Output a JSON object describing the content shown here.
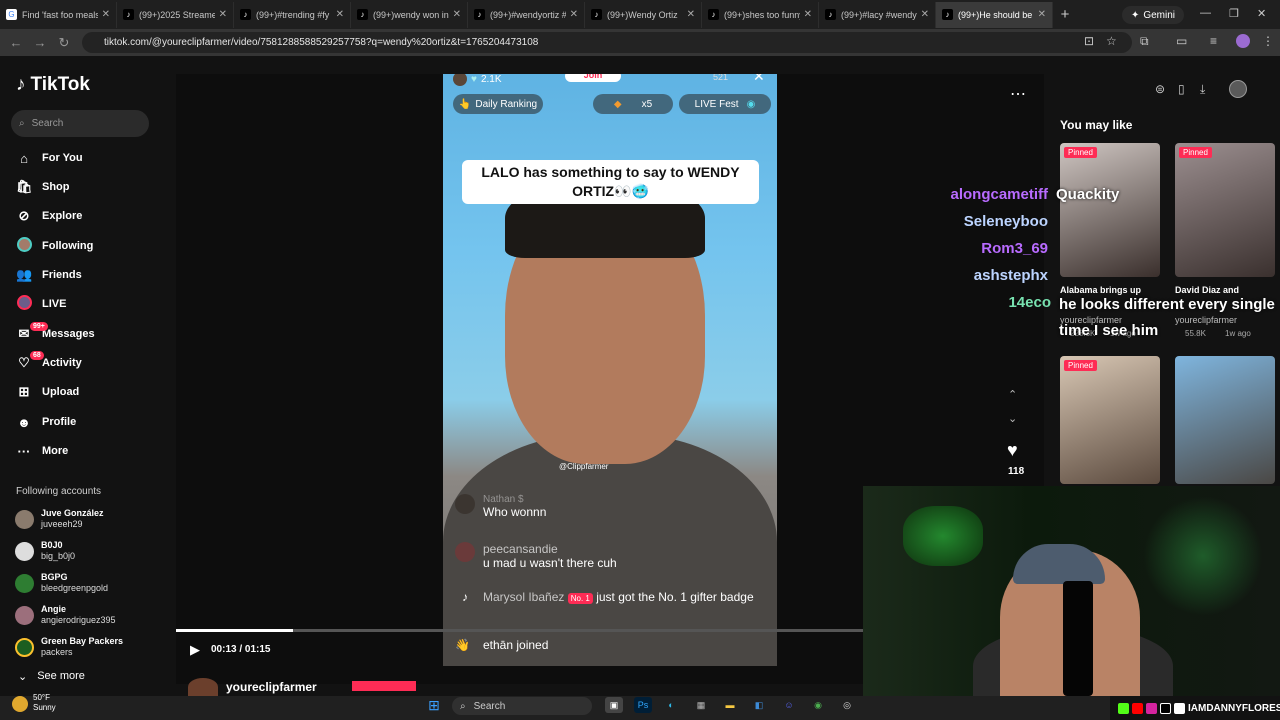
{
  "browser": {
    "tabs": [
      {
        "title": "Find 'fast foo meals"
      },
      {
        "title": "(99+)2025 Streamer"
      },
      {
        "title": "(99+)#trending #fy"
      },
      {
        "title": "(99+)wendy won in"
      },
      {
        "title": "(99+)#wendyortiz #"
      },
      {
        "title": "(99+)Wendy Ortiz"
      },
      {
        "title": "(99+)shes too funny"
      },
      {
        "title": "(99+)#lacy #wendy"
      },
      {
        "title": "(99+)He should be"
      }
    ],
    "gemini_label": "Gemini",
    "url": "tiktok.com/@youreclipfarmer/video/7581288588529257758?q=wendy%20ortiz&t=1765204473108"
  },
  "sidebar": {
    "logo_text": "TikTok",
    "search_placeholder": "Search",
    "nav": [
      {
        "label": "For You",
        "icon": "home-icon"
      },
      {
        "label": "Shop",
        "icon": "bag-icon"
      },
      {
        "label": "Explore",
        "icon": "compass-icon"
      },
      {
        "label": "Following",
        "icon": "following-icon"
      },
      {
        "label": "Friends",
        "icon": "friends-icon"
      },
      {
        "label": "LIVE",
        "icon": "live-icon"
      },
      {
        "label": "Messages",
        "icon": "messages-icon",
        "badge": "99+"
      },
      {
        "label": "Activity",
        "icon": "activity-icon",
        "badge": "68"
      },
      {
        "label": "Upload",
        "icon": "upload-icon"
      },
      {
        "label": "Profile",
        "icon": "profile-icon"
      },
      {
        "label": "More",
        "icon": "more-icon"
      }
    ],
    "following_heading": "Following accounts",
    "accounts": [
      {
        "name": "Juve González",
        "handle": "juveeeh29"
      },
      {
        "name": "B0J0",
        "handle": "big_b0j0"
      },
      {
        "name": "BGPG",
        "handle": "bleedgreenpgold"
      },
      {
        "name": "Angie",
        "handle": "angierodriguez395"
      },
      {
        "name": "Green Bay Packers",
        "handle": "packers"
      }
    ],
    "see_more": "See more"
  },
  "video": {
    "live_top": {
      "viewers": "2.1K",
      "join": "Join",
      "count": "521"
    },
    "daily_ranking": "Daily Ranking",
    "multiplier": "x5",
    "live_fest": "LIVE Fest",
    "caption": "LALO has something to say to WENDY ORTIZ👀🥶",
    "watermark": "@Clippfarmer",
    "chat": [
      {
        "user": "Nathan $",
        "text": "Who wonnn"
      },
      {
        "user": "peecansandie",
        "text": "u mad u wasn't there cuh"
      },
      {
        "user": "Marysol Ibañez",
        "badge": "No. 1",
        "text": "just got the No. 1 gifter badge"
      },
      {
        "user": "",
        "text": "ethān joined"
      }
    ],
    "likes": "118",
    "time": "00:13 / 01:15",
    "progress": 0.17,
    "author": "youreclipfarmer"
  },
  "right_panel": {
    "heading": "You may like",
    "pinned_label": "Pinned",
    "thumbs": [
      {
        "title": "Alabama brings up",
        "author": "youreclipfarmer",
        "views": "228.3K",
        "age": "1w ago"
      },
      {
        "title": "David Diaz and",
        "author": "youreclipfarmer",
        "views": "55.8K",
        "age": "1w ago"
      },
      {
        "title": "",
        "author": "",
        "views": "",
        "age": ""
      },
      {
        "title": "",
        "author": "",
        "views": "",
        "age": ""
      }
    ]
  },
  "stream_overlay": {
    "names": [
      "alongcametiff",
      "Seleneyboo",
      "Rom3_69",
      "ashstephx",
      "14eco"
    ],
    "name_colors": [
      "#b86bff",
      "#bcd4ff",
      "#b86bff",
      "#bcd4ff",
      "#78e2b0"
    ],
    "quackity": "Quackity",
    "message": "he looks different every single time I see him",
    "brand": "IAMDANNYFLORES"
  },
  "taskbar": {
    "temp": "50°F",
    "condition": "Sunny",
    "search": "Search"
  }
}
